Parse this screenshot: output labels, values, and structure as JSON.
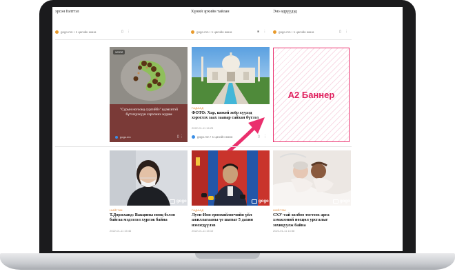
{
  "top_row": [
    {
      "text": "эрсэн бэлтгэл",
      "source": "gogo.mn • 1 цагийн өмнө"
    },
    {
      "text": "Хүний эрхийн тайлан",
      "source": "gogo.mn • 1 цагийн өмнө"
    },
    {
      "text": "Энэ өдрүүдэд",
      "source": "gogo.mn • 1 цагийн өмнө"
    }
  ],
  "cards": [
    {
      "overlay_text": "\"Сурын ногоонд сургийбэ\" идэвхитэй бүтээгдэхүүн хэрэгжих журам",
      "source": "gogo.mn",
      "tag": "ХООЛ"
    },
    {
      "category": "ГАДААД",
      "headline": "ФОТО: Хар, шохой хоёр хүүхэд хэрэглэх заах заавар сайхан бүтээл",
      "date": "2022-01-11 16:25",
      "source": "gogo.mn • 1 цагийн өмнө"
    },
    {
      "category": "НИЙГЭМ",
      "headline": "Т.Доржханд: Вакцины нөөц бэлэн байгаа мэдээлэл хүргэж байна",
      "date": "2022-01-11 15:46",
      "badge": "gogo"
    },
    {
      "category": "ГАДААД",
      "headline": "Лути-Ион ерөнхийлөгчийн үйл ажиллагааны үе шатыг 5 дахин нэмэгдүүлэв",
      "date": "2022-01-11 15:10",
      "badge": "gogo"
    },
    {
      "category": "НИЙГЭМ",
      "headline": "СХУ-тай холбоо тогтоох арга хэмжээний нөхцөл урсгалыг зохицуулж байна",
      "date": "2022-01-11 14:58",
      "badge": "gogo"
    }
  ],
  "banner": {
    "label": "А2 Баннер"
  },
  "colors": {
    "accent": "#ea2f6d",
    "laptop": "#1b1b1d"
  }
}
